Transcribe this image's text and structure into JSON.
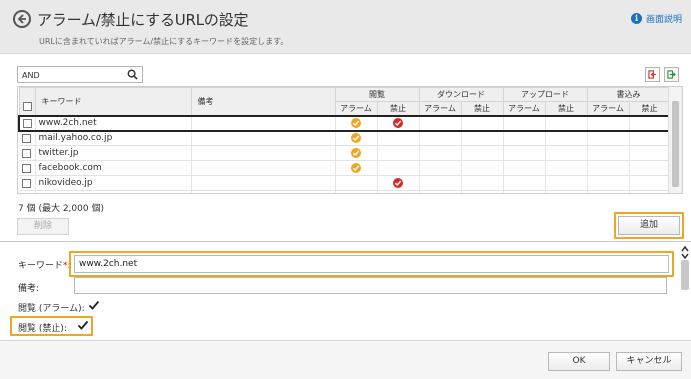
{
  "header": {
    "title": "アラーム/禁止にするURLの設定",
    "subtitle": "URLに含まれていればアラーム/禁止にするキーワードを設定します。",
    "help_label": "画面説明",
    "help_icon": "info-icon"
  },
  "search": {
    "value": "AND",
    "icon": "search-icon"
  },
  "toolbar": {
    "import_icon": "import-icon",
    "export_icon": "export-icon"
  },
  "table": {
    "headers": {
      "keyword": "キーワード",
      "note": "備考",
      "groups": [
        "閲覧",
        "ダウンロード",
        "アップロード",
        "書込み"
      ],
      "alarm": "アラーム",
      "block": "禁止"
    },
    "rows": [
      {
        "keyword": "www.2ch.net",
        "note": "",
        "view_alarm": true,
        "view_block": true,
        "selected": true
      },
      {
        "keyword": "mail.yahoo.co.jp",
        "note": "",
        "view_alarm": true,
        "view_block": false,
        "selected": false
      },
      {
        "keyword": "twitter.jp",
        "note": "",
        "view_alarm": true,
        "view_block": false,
        "selected": false
      },
      {
        "keyword": "facebook.com",
        "note": "",
        "view_alarm": true,
        "view_block": false,
        "selected": false
      },
      {
        "keyword": "nikovideo.jp",
        "note": "",
        "view_alarm": false,
        "view_block": true,
        "selected": false
      }
    ]
  },
  "count_text": "7 個 (最大 2,000 個)",
  "buttons": {
    "delete": "削除",
    "add": "追加",
    "ok": "OK",
    "cancel": "キャンセル"
  },
  "form": {
    "keyword_label": "キーワード",
    "required_mark": "*",
    "colon": ":",
    "keyword_value": "www.2ch.net",
    "note_label": "備考:",
    "note_value": "",
    "view_alarm_label": "閲覧 (アラーム):",
    "view_alarm_checked": true,
    "view_block_label": "閲覧 (禁止):",
    "view_block_checked": true
  },
  "colors": {
    "alarm": "#f0a623",
    "block": "#d22b2b",
    "highlight": "#f0a623",
    "link": "#1a6fc0"
  }
}
